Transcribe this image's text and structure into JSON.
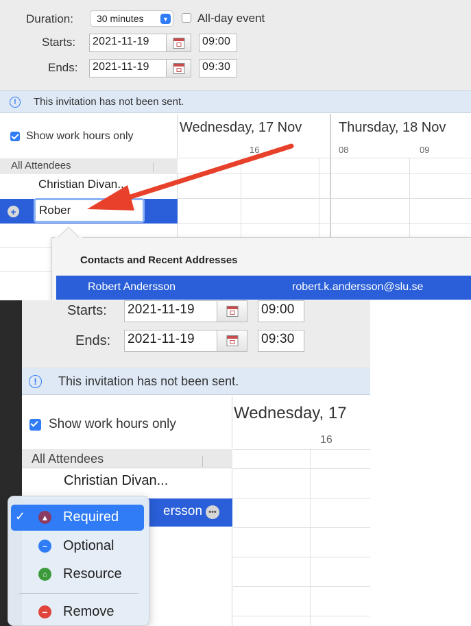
{
  "top": {
    "duration_label": "Duration:",
    "duration_value": "30 minutes",
    "allday_label": "All-day event",
    "starts_label": "Starts:",
    "start_date": "2021-11-19",
    "start_time": "09:00",
    "ends_label": "Ends:",
    "end_date": "2021-11-19",
    "end_time": "09:30",
    "banner": "This invitation has not been sent.",
    "show_work_hours": "Show work hours only",
    "day1": "Wednesday, 17 Nov",
    "day2": "Thursday, 18 Nov",
    "hour_16": "16",
    "hour_08": "08",
    "hour_09": "09",
    "attendees_header": "All Attendees",
    "attendee_1": "Christian Divan...",
    "attendee_input": "Rober",
    "suggest_header": "Contacts and Recent Addresses",
    "suggest_name": "Robert Andersson",
    "suggest_email": "robert.k.andersson@slu.se"
  },
  "bottom": {
    "starts_label": "Starts:",
    "start_date": "2021-11-19",
    "start_time": "09:00",
    "ends_label": "Ends:",
    "end_date": "2021-11-19",
    "end_time": "09:30",
    "banner": "This invitation has not been sent.",
    "show_work_hours": "Show work hours only",
    "day1": "Wednesday, 17",
    "hour_16": "16",
    "attendees_header": "All Attendees",
    "attendee_1": "Christian Divan...",
    "attendee_2_partial": "ersson",
    "menu": {
      "required": "Required",
      "optional": "Optional",
      "resource": "Resource",
      "remove": "Remove"
    }
  },
  "colors": {
    "accent": "#2f7cf6",
    "selection": "#2a5fd9",
    "arrow": "#e8412b"
  }
}
